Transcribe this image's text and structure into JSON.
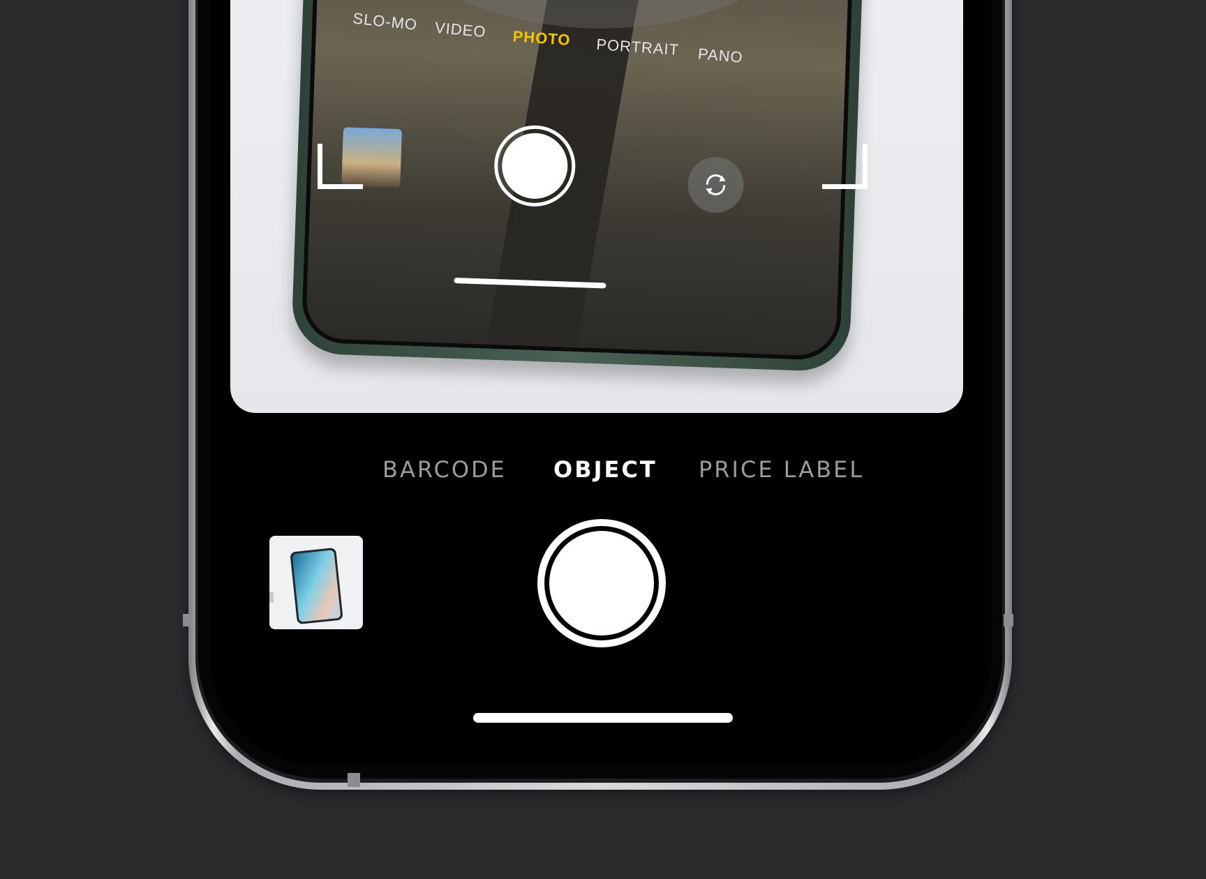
{
  "preview": {
    "inner_modes": [
      "SLO-MO",
      "VIDEO",
      "PHOTO",
      "PORTRAIT",
      "PANO"
    ],
    "inner_active_mode": "PHOTO",
    "accent_color": "#f5c400"
  },
  "scan_modes": {
    "items": [
      "BARCODE",
      "OBJECT",
      "PRICE LABEL"
    ],
    "active": "OBJECT"
  },
  "controls": {
    "shutter_icon": "shutter-button",
    "gallery_icon": "last-photo-thumbnail"
  }
}
